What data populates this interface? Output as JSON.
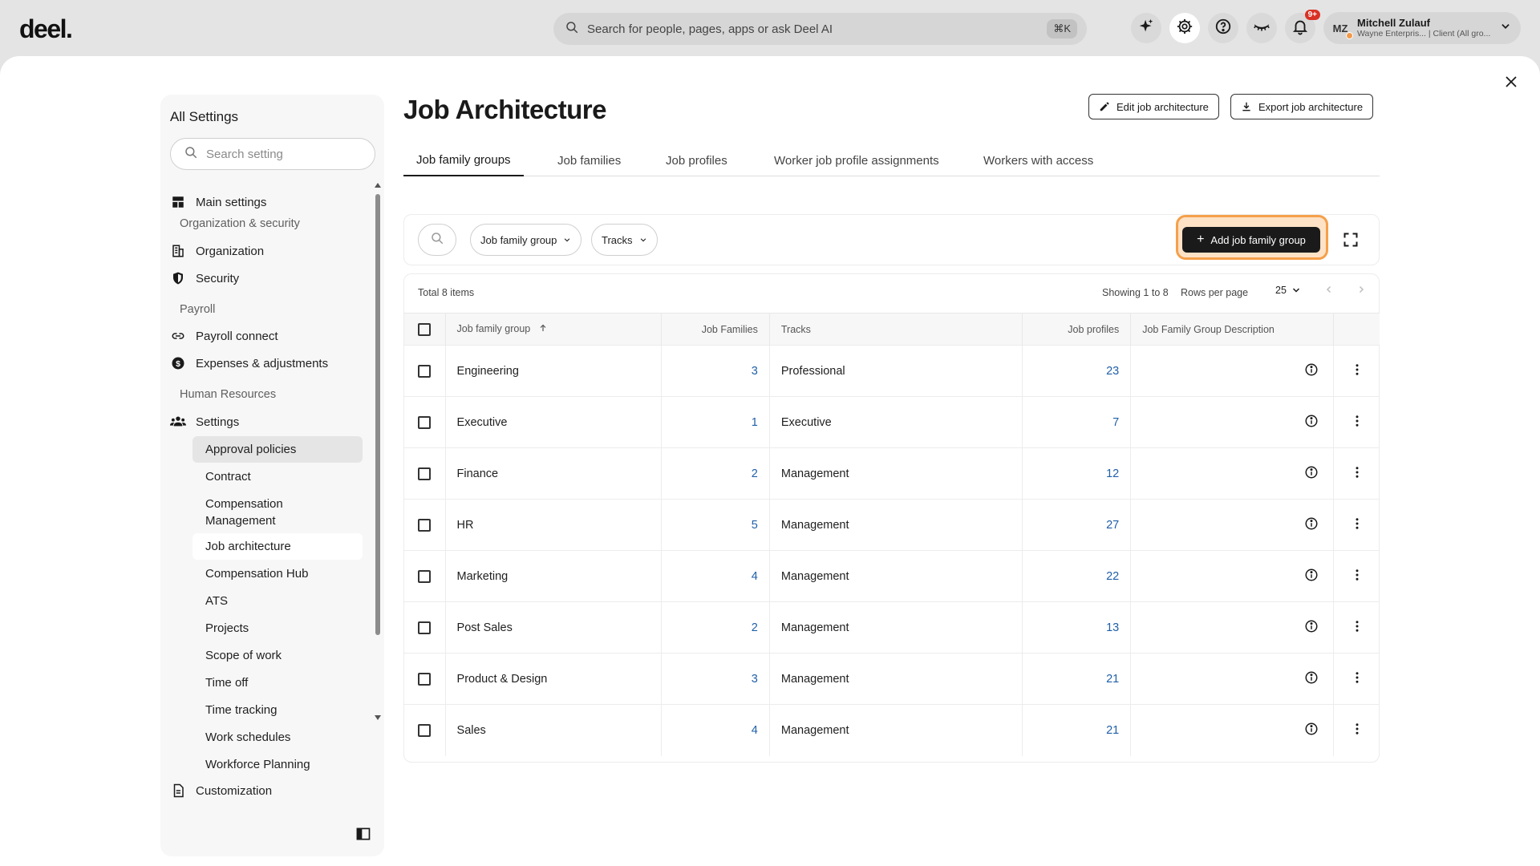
{
  "topbar": {
    "logo": "deel.",
    "search_placeholder": "Search for people, pages, apps or ask Deel AI",
    "search_shortcut": "⌘K",
    "notification_badge": "9+",
    "user_initials": "MZ",
    "user_name": "Mitchell Zulauf",
    "user_sub": "Wayne Enterpris... | Client (All gro..."
  },
  "sidebar": {
    "title": "All Settings",
    "search_placeholder": "Search setting",
    "main_settings": "Main settings",
    "section_org_security": "Organization & security",
    "organization": "Organization",
    "security": "Security",
    "section_payroll": "Payroll",
    "payroll_connect": "Payroll connect",
    "expenses": "Expenses & adjustments",
    "section_hr": "Human Resources",
    "settings": "Settings",
    "sub_items": [
      "Approval policies",
      "Contract",
      "Compensation Management",
      "Job architecture",
      "Compensation Hub",
      "ATS",
      "Projects",
      "Scope of work",
      "Time off",
      "Time tracking",
      "Work schedules",
      "Workforce Planning"
    ],
    "customization": "Customization"
  },
  "page": {
    "title": "Job Architecture",
    "edit_label": "Edit job architecture",
    "export_label": "Export job architecture"
  },
  "tabs": [
    "Job family groups",
    "Job families",
    "Job profiles",
    "Worker job profile assignments",
    "Workers with access"
  ],
  "toolbar": {
    "filter_group": "Job family group",
    "filter_tracks": "Tracks",
    "add_label": "Add job family group"
  },
  "table": {
    "total": "Total 8 items",
    "showing": "Showing 1 to 8",
    "rows_per_page_label": "Rows per page",
    "rows_per_page_value": "25",
    "columns": {
      "group": "Job family group",
      "families": "Job Families",
      "tracks": "Tracks",
      "profiles": "Job profiles",
      "description": "Job Family Group Description"
    },
    "rows": [
      {
        "group": "Engineering",
        "families": "3",
        "tracks": "Professional",
        "profiles": "23"
      },
      {
        "group": "Executive",
        "families": "1",
        "tracks": "Executive",
        "profiles": "7"
      },
      {
        "group": "Finance",
        "families": "2",
        "tracks": "Management",
        "profiles": "12"
      },
      {
        "group": "HR",
        "families": "5",
        "tracks": "Management",
        "profiles": "27"
      },
      {
        "group": "Marketing",
        "families": "4",
        "tracks": "Management",
        "profiles": "22"
      },
      {
        "group": "Post Sales",
        "families": "2",
        "tracks": "Management",
        "profiles": "13"
      },
      {
        "group": "Product & Design",
        "families": "3",
        "tracks": "Management",
        "profiles": "21"
      },
      {
        "group": "Sales",
        "families": "4",
        "tracks": "Management",
        "profiles": "21"
      }
    ]
  },
  "colors": {
    "accent_link": "#1f5fa8",
    "highlight_ring": "#f5a04a",
    "primary_button": "#1a1a1a",
    "notification": "#d93025"
  }
}
